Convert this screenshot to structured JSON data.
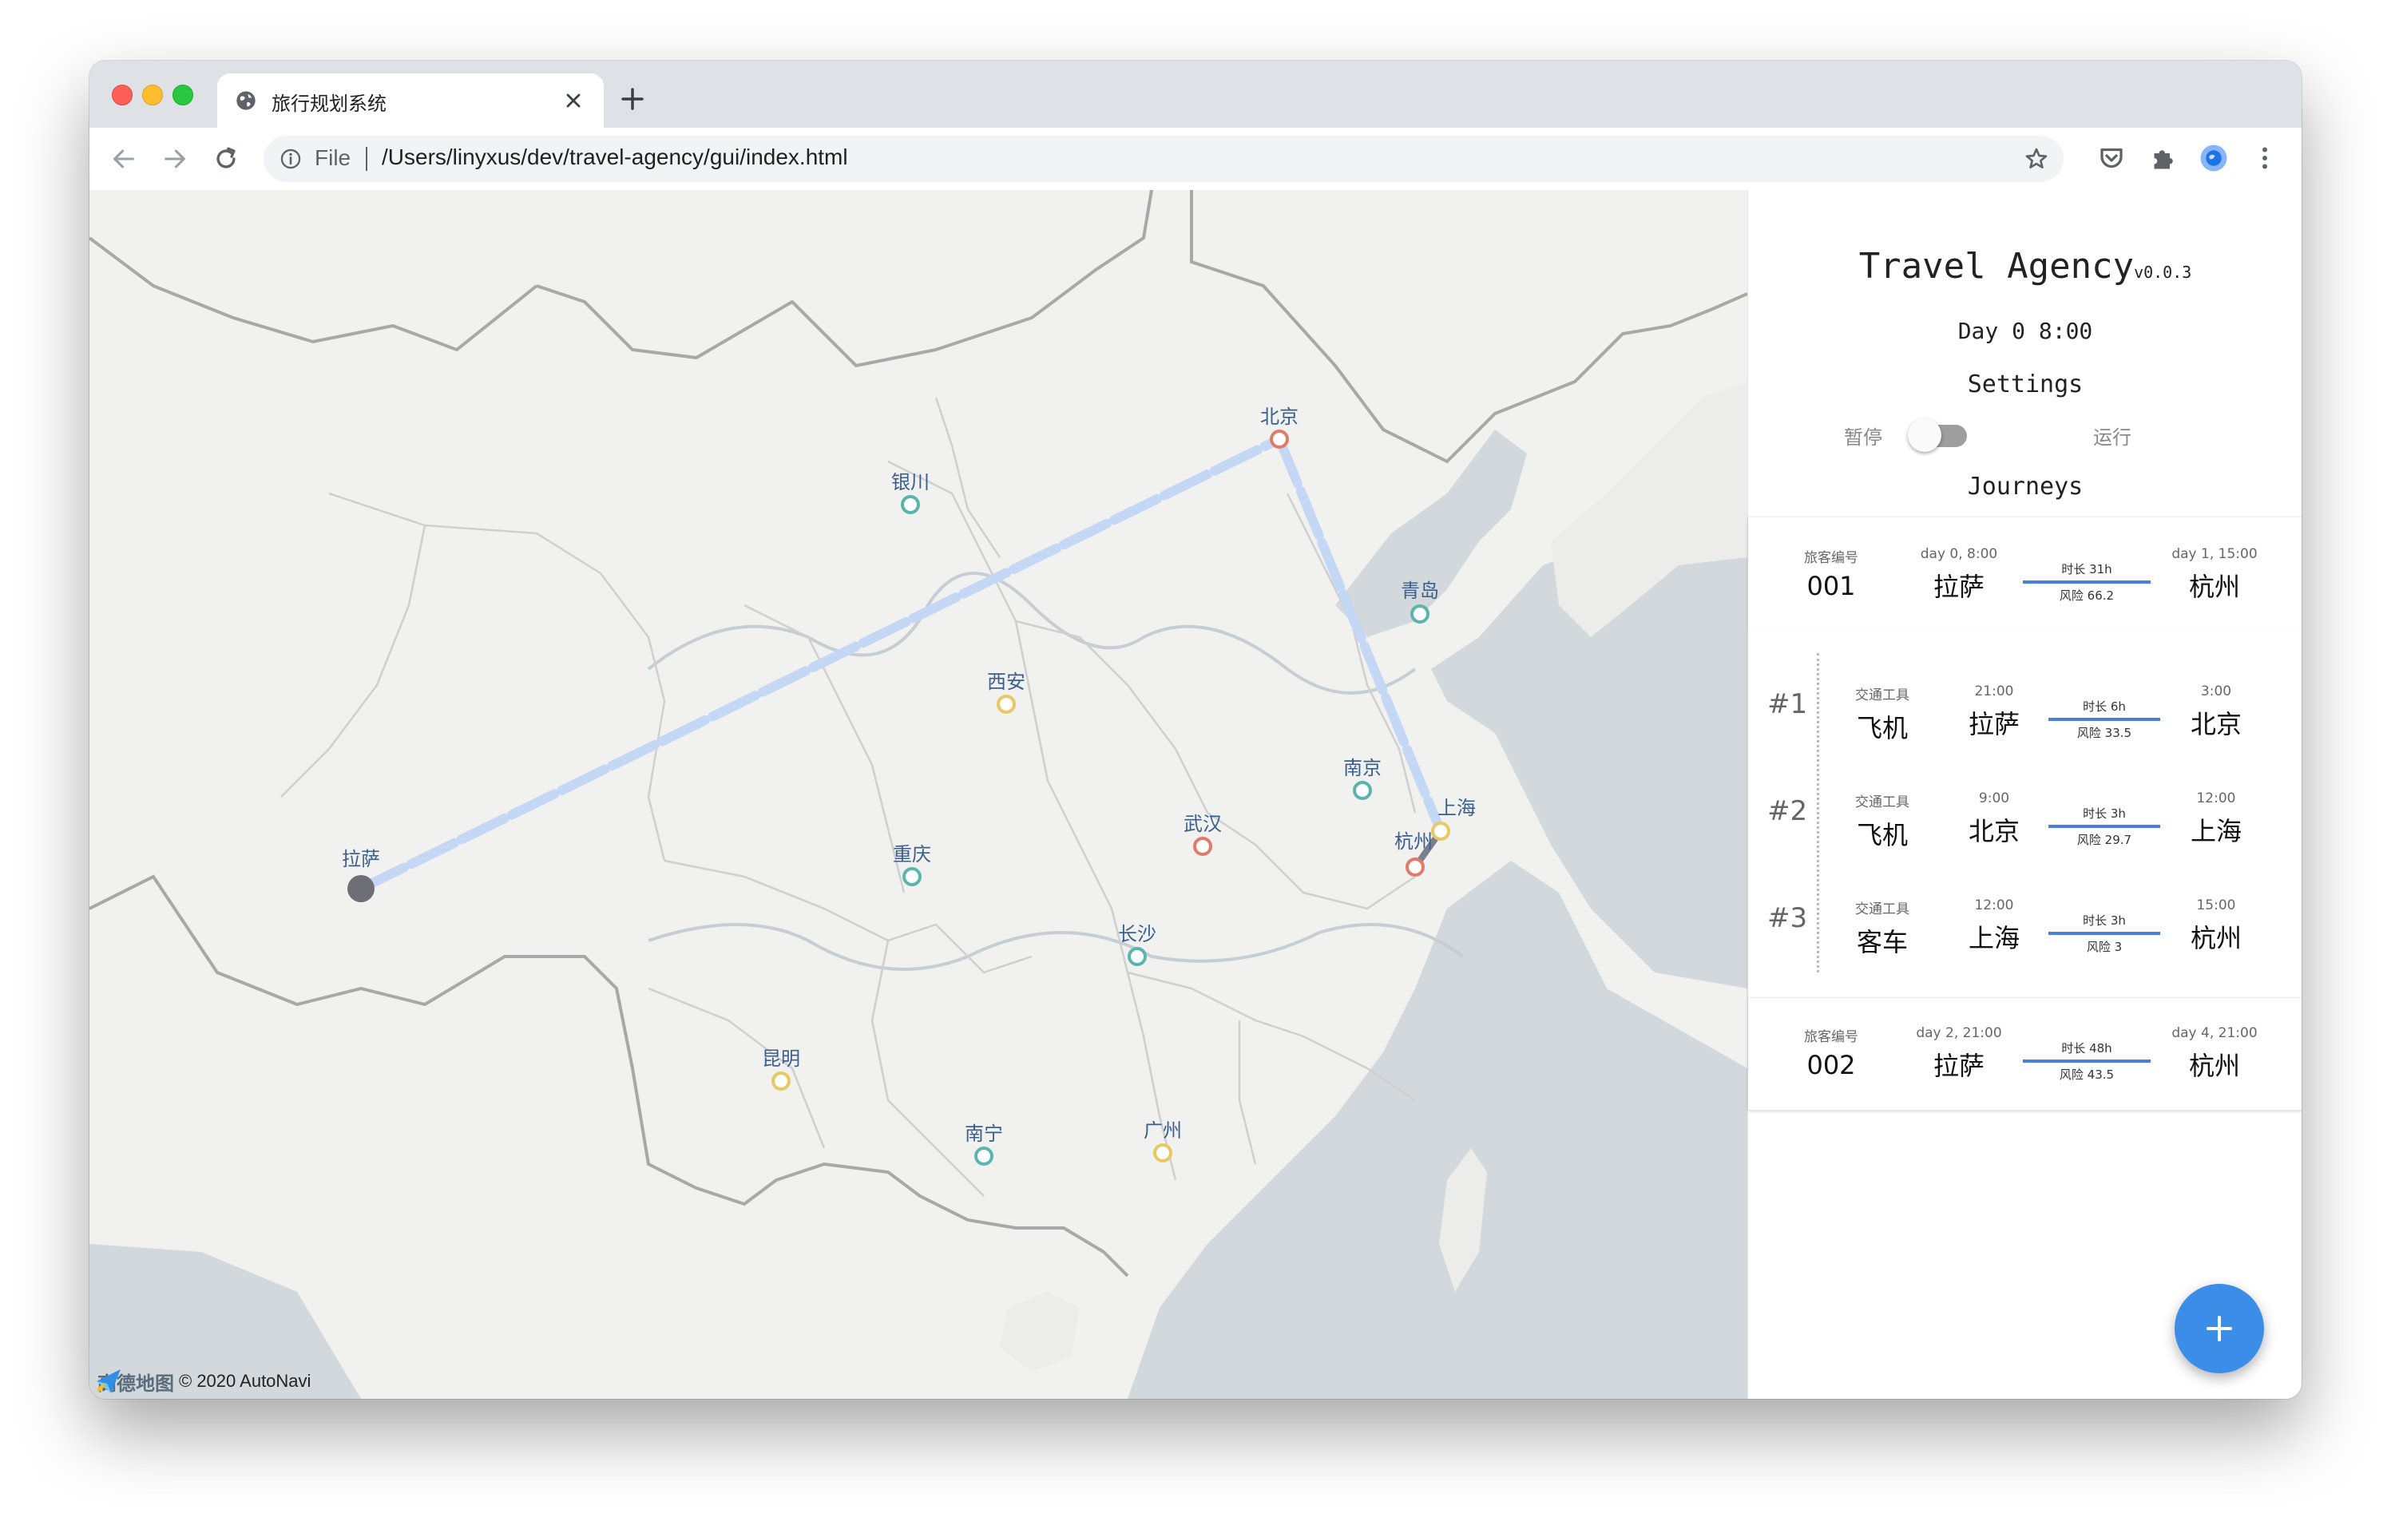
{
  "browser": {
    "tab_title": "旅行规划系统",
    "omnibox_scheme": "File",
    "url": "/Users/linyxus/dev/travel-agency/gui/index.html"
  },
  "map": {
    "attribution_logo": "高德地图",
    "attribution_copy": "© 2020 AutoNavi",
    "cities": [
      {
        "name": "北京",
        "color": "#e07b6a"
      },
      {
        "name": "银川",
        "color": "#5bb5ac"
      },
      {
        "name": "青岛",
        "color": "#5bb5ac"
      },
      {
        "name": "西安",
        "color": "#e8c862"
      },
      {
        "name": "南京",
        "color": "#5bb5ac"
      },
      {
        "name": "上海",
        "color": "#e8c862"
      },
      {
        "name": "杭州",
        "color": "#e07b6a"
      },
      {
        "name": "武汉",
        "color": "#e07b6a"
      },
      {
        "name": "重庆",
        "color": "#5bb5ac"
      },
      {
        "name": "长沙",
        "color": "#5bb5ac"
      },
      {
        "name": "拉萨",
        "color": "#6e6e76"
      },
      {
        "name": "昆明",
        "color": "#e8c862"
      },
      {
        "name": "南宁",
        "color": "#5bb5ac"
      },
      {
        "name": "广州",
        "color": "#e8c862"
      }
    ],
    "route_color": "#c4d7f5"
  },
  "panel": {
    "title": "Travel Agency",
    "version": "v0.0.3",
    "clock": "Day 0 8:00",
    "settings_heading": "Settings",
    "toggle_off_label": "暂停",
    "toggle_on_label": "运行",
    "toggle_running": false,
    "journeys_heading": "Journeys",
    "journeys": [
      {
        "id_label": "旅客编号",
        "id": "001",
        "start_time": "day 0, 8:00",
        "from": "拉萨",
        "duration": "时长 31h",
        "risk": "风险 66.2",
        "end_time": "day 1, 15:00",
        "to": "杭州",
        "steps": [
          {
            "num": "#1",
            "mode_label": "交通工具",
            "mode": "飞机",
            "start_time": "21:00",
            "from": "拉萨",
            "duration": "时长 6h",
            "risk": "风险 33.5",
            "end_time": "3:00",
            "to": "北京"
          },
          {
            "num": "#2",
            "mode_label": "交通工具",
            "mode": "飞机",
            "start_time": "9:00",
            "from": "北京",
            "duration": "时长 3h",
            "risk": "风险 29.7",
            "end_time": "12:00",
            "to": "上海"
          },
          {
            "num": "#3",
            "mode_label": "交通工具",
            "mode": "客车",
            "start_time": "12:00",
            "from": "上海",
            "duration": "时长 3h",
            "risk": "风险 3",
            "end_time": "15:00",
            "to": "杭州"
          }
        ]
      },
      {
        "id_label": "旅客编号",
        "id": "002",
        "start_time": "day 2, 21:00",
        "from": "拉萨",
        "duration": "时长 48h",
        "risk": "风险 43.5",
        "end_time": "day 4, 21:00",
        "to": "杭州"
      }
    ],
    "accent": "#3b8de8"
  }
}
